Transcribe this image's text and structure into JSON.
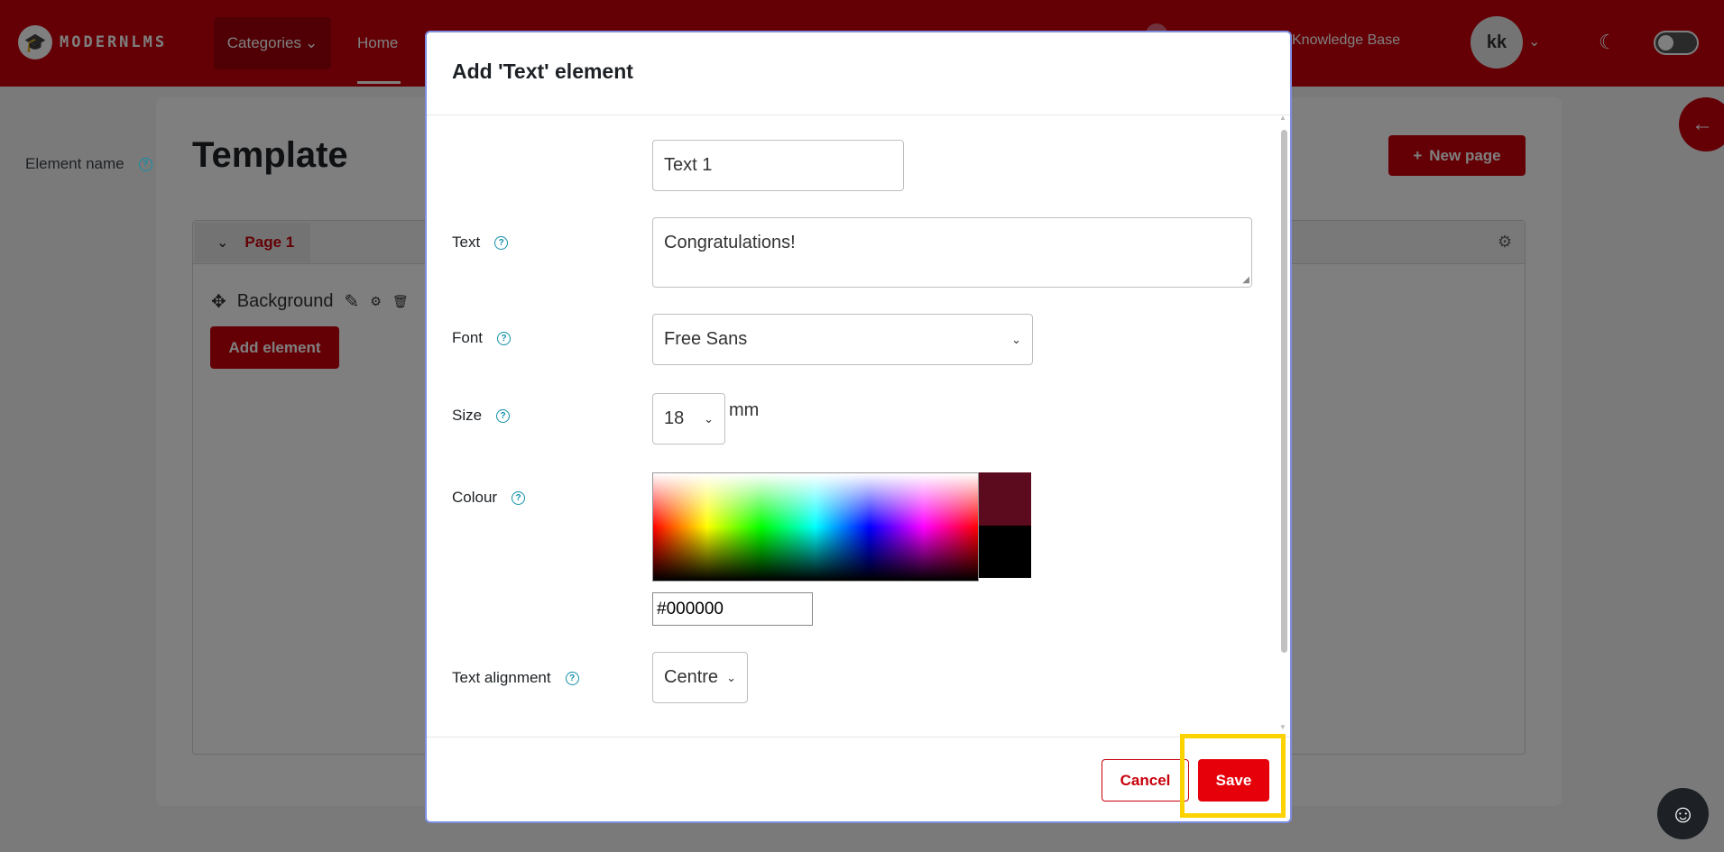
{
  "navbar": {
    "logo_text": "MODERNLMS",
    "categories_label": "Categories",
    "home_label": "Home",
    "knowledge_base_label": "Knowledge Base",
    "avatar_initials": "kk"
  },
  "page": {
    "title": "Template",
    "new_page_label": "New page",
    "page_tab_label": "Page 1",
    "background_label": "Background",
    "add_element_label": "Add element"
  },
  "modal": {
    "title": "Add 'Text' element",
    "fields": {
      "element_name": {
        "label": "Element name",
        "value": "Text 1"
      },
      "text": {
        "label": "Text",
        "value": "Congratulations!"
      },
      "font": {
        "label": "Font",
        "value": "Free Sans"
      },
      "size": {
        "label": "Size",
        "value": "18",
        "unit": "mm"
      },
      "colour": {
        "label": "Colour",
        "value": "#000000",
        "swatch_hover": "#5c0a1e",
        "swatch_current": "#000000"
      },
      "alignment": {
        "label": "Text alignment",
        "value": "Centre"
      }
    },
    "cancel_label": "Cancel",
    "save_label": "Save"
  },
  "colors": {
    "brand": "#c8000b",
    "save": "#e5000a",
    "highlight": "#fcd200",
    "help": "#0f8fa8"
  },
  "icons": {
    "help": "question-circle",
    "chevron": "chevron-down",
    "drawer": "arrow-left",
    "accessibility": "accessibility"
  }
}
